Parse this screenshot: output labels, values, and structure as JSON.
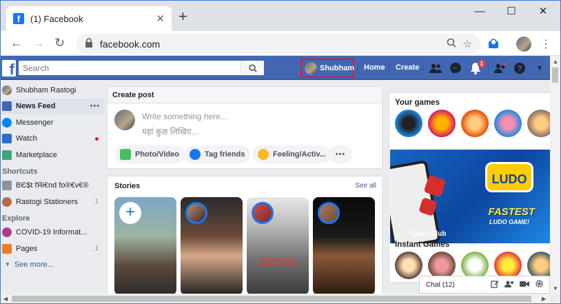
{
  "browser": {
    "tab_title": "(1) Facebook",
    "url": "facebook.com"
  },
  "fb": {
    "search_placeholder": "Search",
    "profile_name": "Shubham",
    "nav_home": "Home",
    "nav_create": "Create",
    "notifications_count": "1",
    "brand_color": "#4267b2"
  },
  "sidebar": {
    "user": "Shubham Rastogi",
    "items": [
      {
        "label": "News Feed",
        "icon": "newsfeed-icon"
      },
      {
        "label": "Messenger",
        "icon": "messenger-icon"
      },
      {
        "label": "Watch",
        "icon": "watch-icon"
      },
      {
        "label": "Marketplace",
        "icon": "marketplace-icon"
      }
    ],
    "shortcuts_title": "Shortcuts",
    "shortcuts": [
      {
        "label": "BЄ$t fЯi€nd fo®€v€®",
        "count": ""
      },
      {
        "label": "Rastogi Stationers",
        "count": "1"
      }
    ],
    "explore_title": "Explore",
    "explore": [
      {
        "label": "COVID-19 Informat...",
        "count": ""
      },
      {
        "label": "Pages",
        "count": "1"
      }
    ],
    "see_more": "See more..."
  },
  "create_post": {
    "title": "Create post",
    "placeholder_en": "Write something here...",
    "placeholder_hi": "यहां कुछ लिखिए...",
    "actions": [
      "Photo/Video",
      "Tag friends",
      "Feeling/Activ..."
    ]
  },
  "stories": {
    "title": "Stories",
    "see_all": "See all",
    "story3_caption": "KHUSHI KOSA\nI MISS YOU BABY"
  },
  "right": {
    "your_games": "Your games",
    "ad_name": "Ludo Club",
    "ad_logo": "LUDO",
    "ad_headline": "FASTEST",
    "ad_sub": "LUDO GAME!",
    "instant_games": "Instant Games"
  },
  "chat": {
    "label": "Chat (12)"
  }
}
